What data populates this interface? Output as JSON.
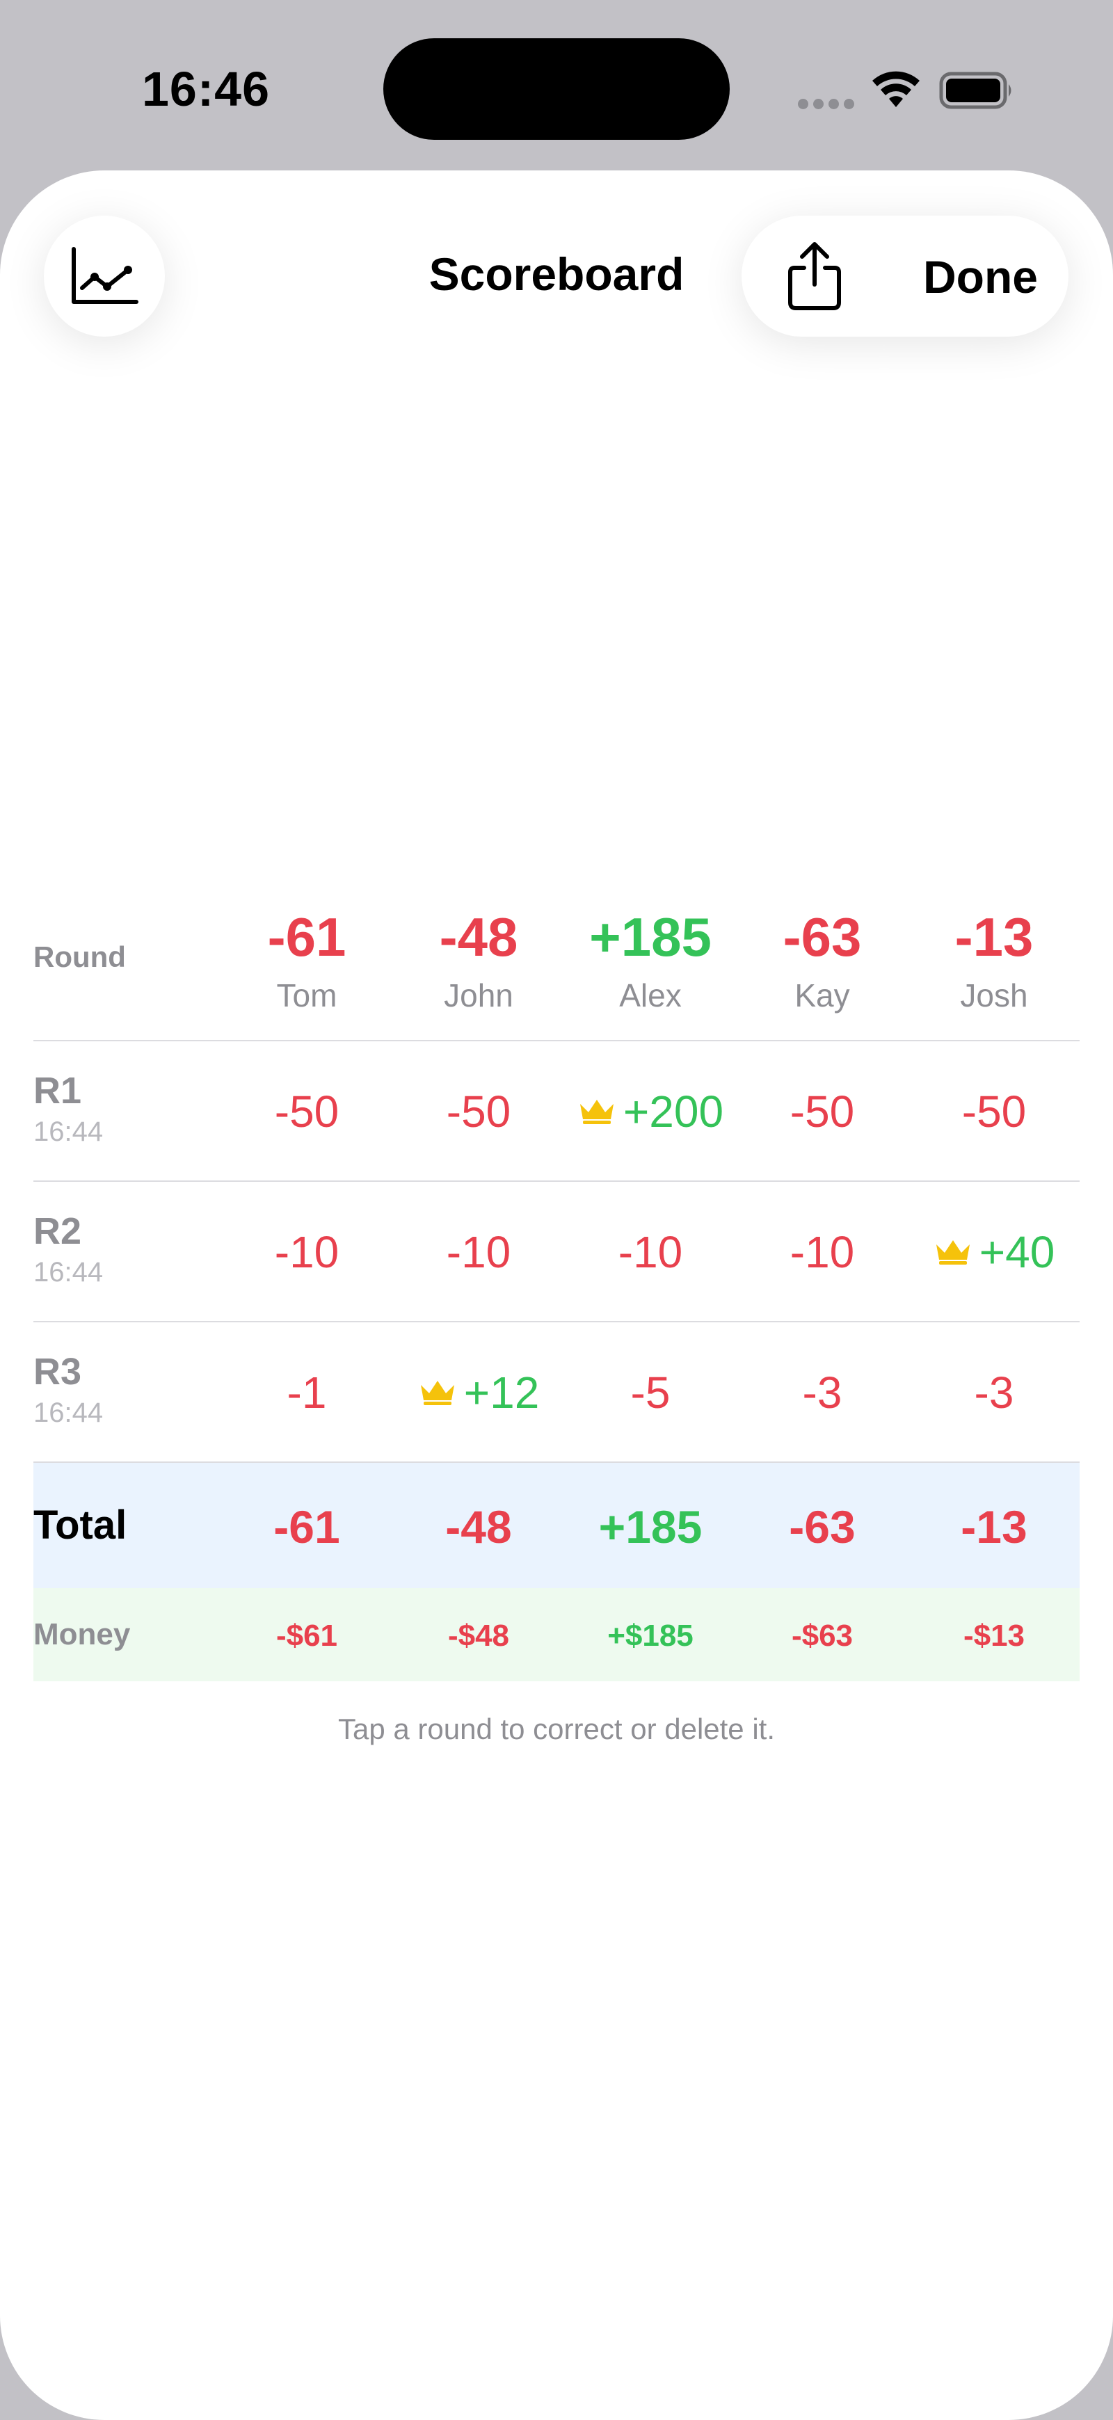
{
  "status_bar": {
    "time": "16:46"
  },
  "header": {
    "title": "Scoreboard",
    "done_label": "Done",
    "chart_icon": "line-chart-icon",
    "share_icon": "share-icon"
  },
  "table": {
    "round_header": "Round",
    "players": [
      {
        "name": "Tom",
        "total": "-61",
        "status": "negative"
      },
      {
        "name": "John",
        "total": "-48",
        "status": "negative"
      },
      {
        "name": "Alex",
        "total": "+185",
        "status": "positive"
      },
      {
        "name": "Kay",
        "total": "-63",
        "status": "negative"
      },
      {
        "name": "Josh",
        "total": "-13",
        "status": "negative"
      }
    ],
    "rounds": [
      {
        "name": "R1",
        "time": "16:44",
        "values": [
          "-50",
          "-50",
          "+200",
          "-50",
          "-50"
        ],
        "winner_index": 2
      },
      {
        "name": "R2",
        "time": "16:44",
        "values": [
          "-10",
          "-10",
          "-10",
          "-10",
          "+40"
        ],
        "winner_index": 4
      },
      {
        "name": "R3",
        "time": "16:44",
        "values": [
          "-1",
          "+12",
          "-5",
          "-3",
          "-3"
        ],
        "winner_index": 1
      }
    ],
    "total_label": "Total",
    "totals": [
      "-61",
      "-48",
      "+185",
      "-63",
      "-13"
    ],
    "money_label": "Money",
    "money": [
      "-$61",
      "-$48",
      "+$185",
      "-$63",
      "-$13"
    ]
  },
  "hint": "Tap a round to correct or delete it.",
  "colors": {
    "negative": "#e8404d",
    "positive": "#34c258",
    "crown": "#f5c20b",
    "total_bg": "#eaf3fe",
    "money_bg": "#eefaef"
  }
}
